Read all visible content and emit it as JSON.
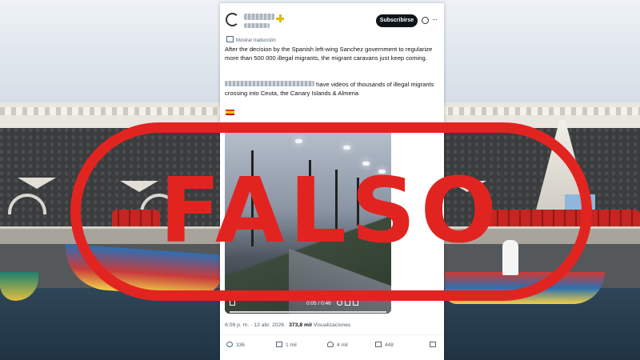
{
  "tweet": {
    "author_name": "",
    "author_handle": "",
    "subscribe_label": "Subscribirse",
    "more_label": "···",
    "translation_label": "Mostrar traducción",
    "text_line1": "After the decision by the Spanish left-wing Sanchez government to regularize more than 500 000 illegal migrants, the migrant caravans just keep coming.",
    "text_line2": "have videos of thousands of illegal migrants crossing into Ceuta, the Canary Islands & Almeria",
    "flag_icon": "spain-flag-icon",
    "video": {
      "time": "0:05 / 0:46"
    },
    "meta": {
      "time": "6:06 p. m.",
      "date": "13 abr. 2026",
      "views_count": "373,8 mil",
      "views_label": "Visualizaciones"
    },
    "actions": {
      "replies": "336",
      "retweets": "1 mil",
      "likes": "4 mil",
      "bookmarks": "448"
    }
  },
  "overlay": {
    "stamp_text": "FALSO",
    "stamp_color": "#e22421"
  },
  "colors": {
    "subscribe_bg": "#0f1419",
    "secondary_text": "#536471"
  }
}
